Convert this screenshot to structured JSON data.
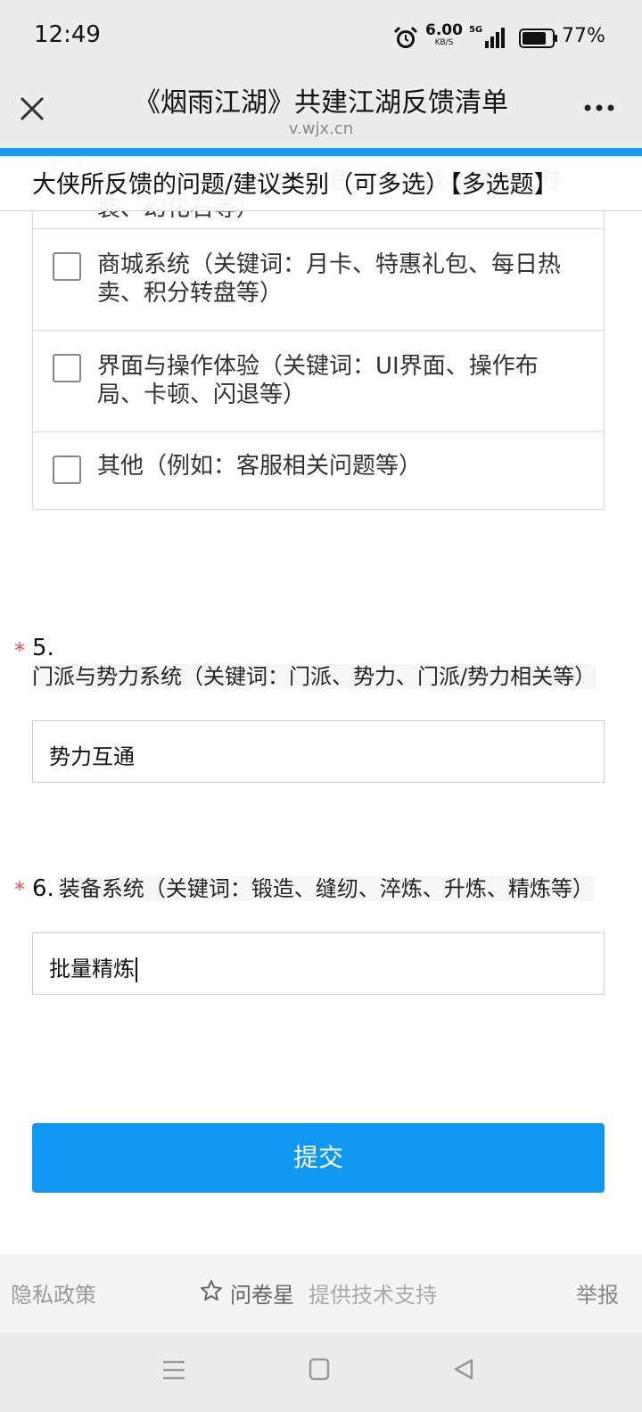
{
  "status_bar": {
    "time": "12:49",
    "net_speed_value": "6.00",
    "net_speed_unit": "KB/S",
    "network_type": "5G",
    "battery": "77%"
  },
  "header": {
    "title": "《烟雨江湖》共建江湖反馈清单",
    "domain": "v.wjx.cn"
  },
  "progress": {
    "fraction": 1.0
  },
  "sticky_question": "大侠所反馈的问题/建议类别（可多选）【多选题】",
  "options": [
    {
      "label": "美术相关（关键词：角色立绘、战斗表现、时装、幻化石等）",
      "checked": false
    },
    {
      "label": "商城系统（关键词：月卡、特惠礼包、每日热卖、积分转盘等）",
      "checked": false
    },
    {
      "label": "界面与操作体验（关键词：UI界面、操作布局、卡顿、闪退等）",
      "checked": false
    },
    {
      "label": "其他（例如：客服相关问题等）",
      "checked": false
    }
  ],
  "questions": [
    {
      "required_mark": "*",
      "number": "5.",
      "title": "门派与势力系统（关键词：门派、势力、门派/势力相关等）",
      "answer": "势力互通"
    },
    {
      "required_mark": "*",
      "number": "6.",
      "title": "装备系统（关键词：锻造、缝纫、淬炼、升炼、精炼等）",
      "answer": "批量精炼"
    }
  ],
  "submit_label": "提交",
  "footer": {
    "privacy": "隐私政策",
    "brand_name": "问卷星",
    "powered": "提供技术支持",
    "report": "举报"
  },
  "icons": {
    "close": "close-icon",
    "more": "more-icon",
    "star": "star-icon",
    "alarm": "alarm-icon"
  },
  "colors": {
    "accent": "#0f97f2",
    "required": "#e35050"
  }
}
